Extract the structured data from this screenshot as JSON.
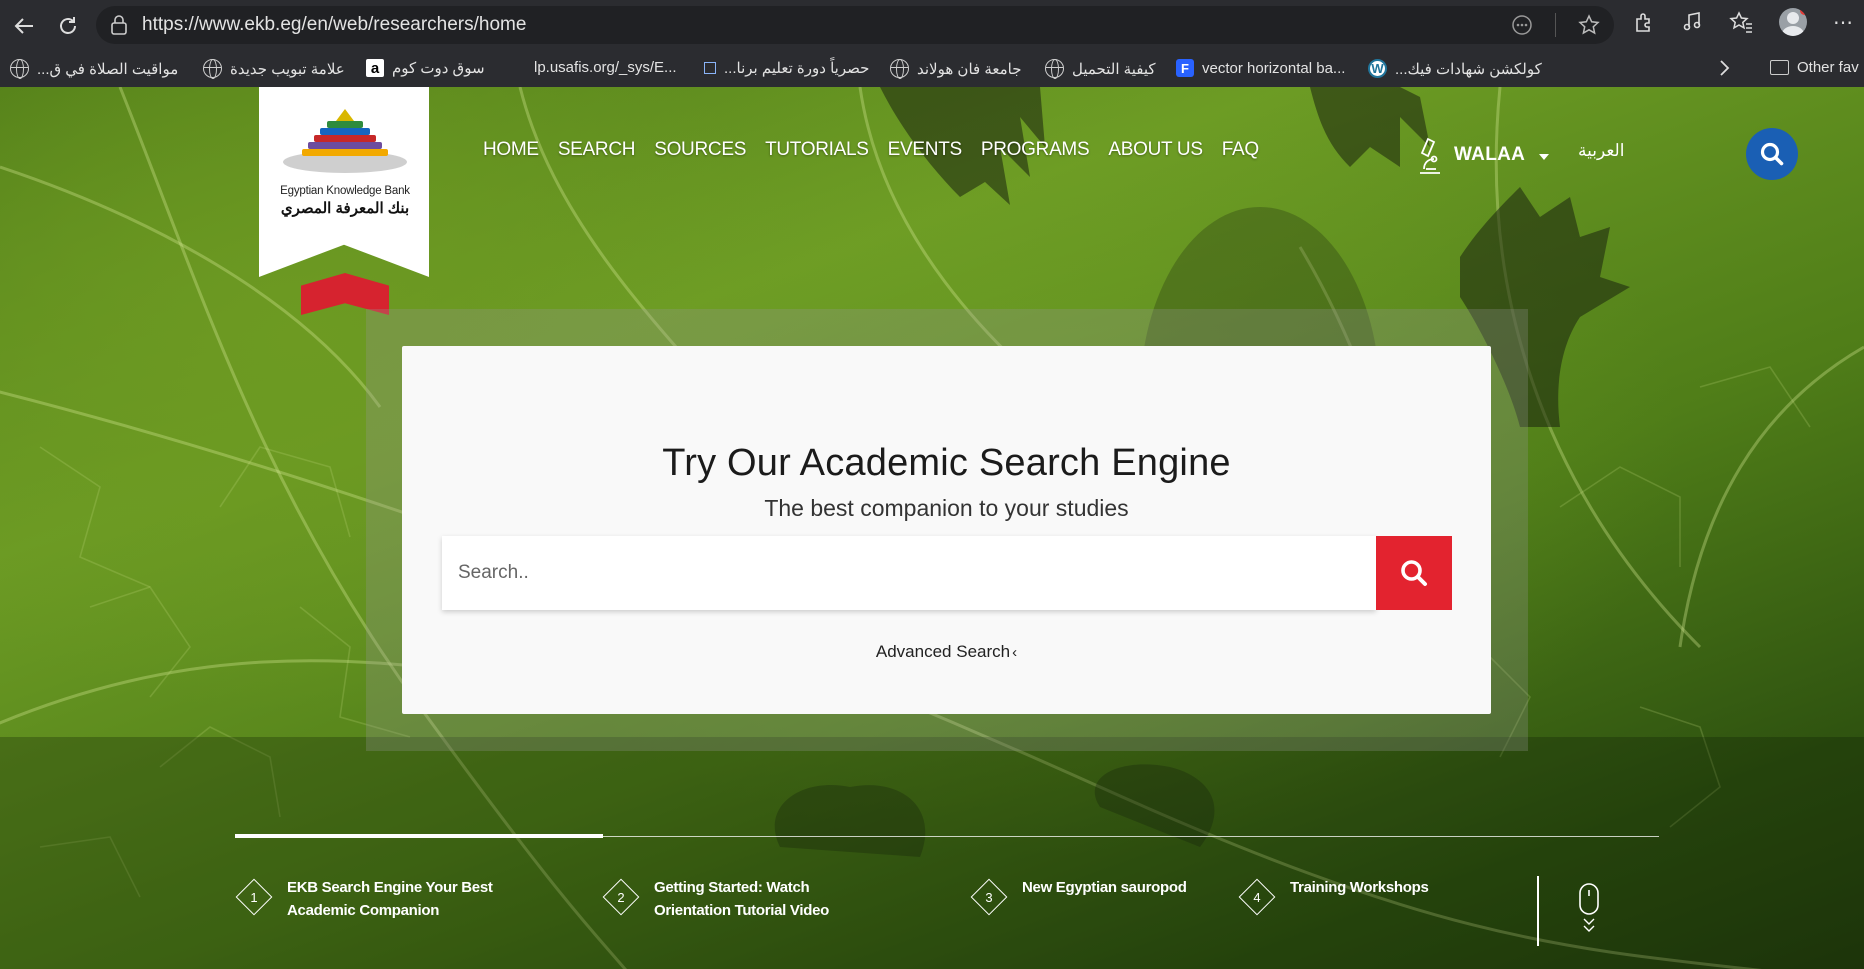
{
  "browser": {
    "url": "https://www.ekb.eg/en/web/researchers/home",
    "bookmarks": [
      {
        "label": "مواقيت الصلاة في ق...",
        "icon": "globe-icon"
      },
      {
        "label": "علامة تبويب جديدة",
        "icon": "globe-icon"
      },
      {
        "label": "سوق دوت كوم",
        "icon": "amazon-icon"
      },
      {
        "label": "lp.usafis.org/_sys/E...",
        "icon": "blank-icon"
      },
      {
        "label": "حصرياً دورة تعليم برنا...",
        "icon": "page-icon"
      },
      {
        "label": "جامعة فان هولاند",
        "icon": "globe-icon"
      },
      {
        "label": "كيفية التحميل",
        "icon": "globe-icon"
      },
      {
        "label": "vector horizontal ba...",
        "icon": "freepik-icon"
      },
      {
        "label": "كولكشن شهادات فيك...",
        "icon": "wordpress-icon"
      }
    ],
    "other_favorites": "Other fav"
  },
  "logo": {
    "name_en": "Egyptian Knowledge Bank",
    "name_ar": "بنك المعرفة المصري"
  },
  "nav": {
    "items": [
      "HOME",
      "SEARCH",
      "SOURCES",
      "TUTORIALS",
      "EVENTS",
      "PROGRAMS",
      "ABOUT US",
      "FAQ"
    ]
  },
  "user": {
    "name": "WALAA",
    "language_link": "العربية"
  },
  "search_card": {
    "title": "Try Our Academic Search Engine",
    "subtitle": "The best companion to your studies",
    "placeholder": "Search..",
    "advanced_label": "Advanced Search",
    "advanced_chevron": "‹"
  },
  "slider": {
    "active_index": 1,
    "items": [
      {
        "number": "1",
        "text": "EKB Search Engine Your Best Academic Companion"
      },
      {
        "number": "2",
        "text": "Getting Started: Watch Orientation Tutorial Video"
      },
      {
        "number": "3",
        "text": "New Egyptian sauropod"
      },
      {
        "number": "4",
        "text": "Training Workshops"
      }
    ]
  },
  "colors": {
    "accent_red": "#e3232f",
    "accent_blue": "#1a5fb4",
    "leaf_green": "#5c8a1e"
  }
}
